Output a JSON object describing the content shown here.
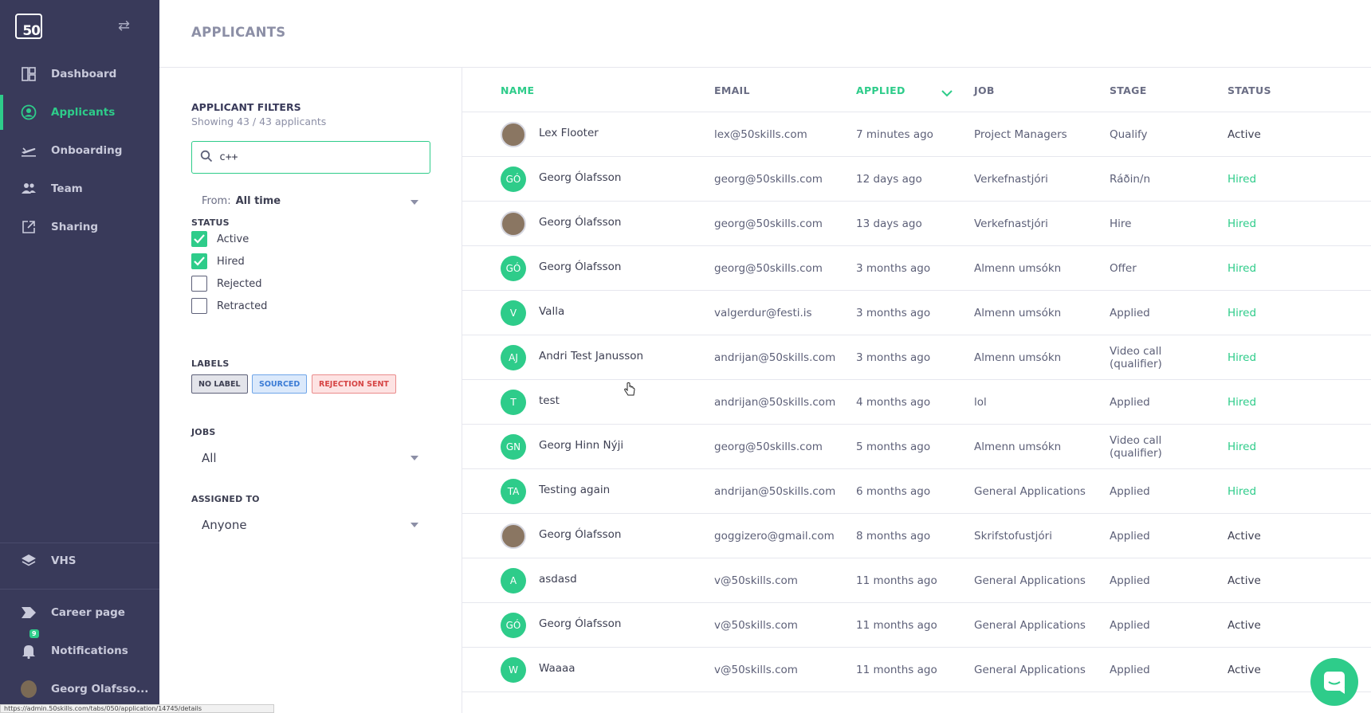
{
  "sidebar": {
    "logo": "50",
    "items": [
      {
        "label": "Dashboard",
        "icon": "dashboard-icon"
      },
      {
        "label": "Applicants",
        "icon": "user-circle-icon"
      },
      {
        "label": "Onboarding",
        "icon": "plane-icon"
      },
      {
        "label": "Team",
        "icon": "team-icon"
      },
      {
        "label": "Sharing",
        "icon": "share-icon"
      }
    ],
    "bottom": [
      {
        "label": "VHS",
        "icon": "layers-icon"
      },
      {
        "label": "Career page",
        "icon": "tag-icon"
      },
      {
        "label": "Notifications",
        "icon": "bell-icon",
        "badge": "9"
      },
      {
        "label": "Georg Olafsso..."
      }
    ]
  },
  "header": {
    "title": "APPLICANTS"
  },
  "filters": {
    "title": "APPLICANT FILTERS",
    "subtitle": "Showing 43 / 43 applicants",
    "search_value": "c++",
    "from_label": "From:",
    "from_value": "All time",
    "status_label": "STATUS",
    "status": [
      {
        "label": "Active",
        "checked": true
      },
      {
        "label": "Hired",
        "checked": true
      },
      {
        "label": "Rejected",
        "checked": false
      },
      {
        "label": "Retracted",
        "checked": false
      }
    ],
    "labels_label": "LABELS",
    "labels": [
      "NO LABEL",
      "SOURCED",
      "REJECTION SENT"
    ],
    "jobs_label": "JOBS",
    "jobs_value": "All",
    "assigned_label": "ASSIGNED TO",
    "assigned_value": "Anyone"
  },
  "table": {
    "columns": [
      "NAME",
      "EMAIL",
      "APPLIED",
      "JOB",
      "STAGE",
      "STATUS"
    ],
    "rows": [
      {
        "initials": "",
        "photo": true,
        "name": "Lex Flooter",
        "email": "lex@50skills.com",
        "applied": "7 minutes ago",
        "job": "Project Managers",
        "stage": "Qualify",
        "status": "Active"
      },
      {
        "initials": "GÓ",
        "photo": false,
        "name": "Georg Ólafsson",
        "email": "georg@50skills.com",
        "applied": "12 days ago",
        "job": "Verkefnastjóri",
        "stage": "Ráðin/n",
        "status": "Hired"
      },
      {
        "initials": "",
        "photo": true,
        "name": "Georg Ólafsson",
        "email": "georg@50skills.com",
        "applied": "13 days ago",
        "job": "Verkefnastjóri",
        "stage": "Hire",
        "status": "Hired"
      },
      {
        "initials": "GÓ",
        "photo": false,
        "name": "Georg Ólafsson",
        "email": "georg@50skills.com",
        "applied": "3 months ago",
        "job": "Almenn umsókn",
        "stage": "Offer",
        "status": "Hired"
      },
      {
        "initials": "V",
        "photo": false,
        "name": "Valla",
        "email": "valgerdur@festi.is",
        "applied": "3 months ago",
        "job": "Almenn umsókn",
        "stage": "Applied",
        "status": "Hired"
      },
      {
        "initials": "AJ",
        "photo": false,
        "name": "Andri Test Janusson",
        "email": "andrijan@50skills.com",
        "applied": "3 months ago",
        "job": "Almenn umsókn",
        "stage": "Video call (qualifier)",
        "status": "Hired"
      },
      {
        "initials": "T",
        "photo": false,
        "name": "test",
        "email": "andrijan@50skills.com",
        "applied": "4 months ago",
        "job": "lol",
        "stage": "Applied",
        "status": "Hired"
      },
      {
        "initials": "GN",
        "photo": false,
        "name": "Georg Hinn Nýji",
        "email": "georg@50skills.com",
        "applied": "5 months ago",
        "job": "Almenn umsókn",
        "stage": "Video call (qualifier)",
        "status": "Hired"
      },
      {
        "initials": "TA",
        "photo": false,
        "name": "Testing again",
        "email": "andrijan@50skills.com",
        "applied": "6 months ago",
        "job": "General Applications",
        "stage": "Applied",
        "status": "Hired"
      },
      {
        "initials": "",
        "photo": true,
        "name": "Georg Ólafsson",
        "email": "goggizero@gmail.com",
        "applied": "8 months ago",
        "job": "Skrifstofustjóri",
        "stage": "Applied",
        "status": "Active"
      },
      {
        "initials": "A",
        "photo": false,
        "name": "asdasd",
        "email": "v@50skills.com",
        "applied": "11 months ago",
        "job": "General Applications",
        "stage": "Applied",
        "status": "Active"
      },
      {
        "initials": "GÓ",
        "photo": false,
        "name": "Georg Ólafsson",
        "email": "v@50skills.com",
        "applied": "11 months ago",
        "job": "General Applications",
        "stage": "Applied",
        "status": "Active"
      },
      {
        "initials": "W",
        "photo": false,
        "name": "Waaaa",
        "email": "v@50skills.com",
        "applied": "11 months ago",
        "job": "General Applications",
        "stage": "Applied",
        "status": "Active"
      }
    ]
  },
  "status_url": "https://admin.50skills.com/tabs/050/application/14745/details",
  "colors": {
    "sidebar": "#393a5a",
    "accent": "#2ecc8a"
  }
}
